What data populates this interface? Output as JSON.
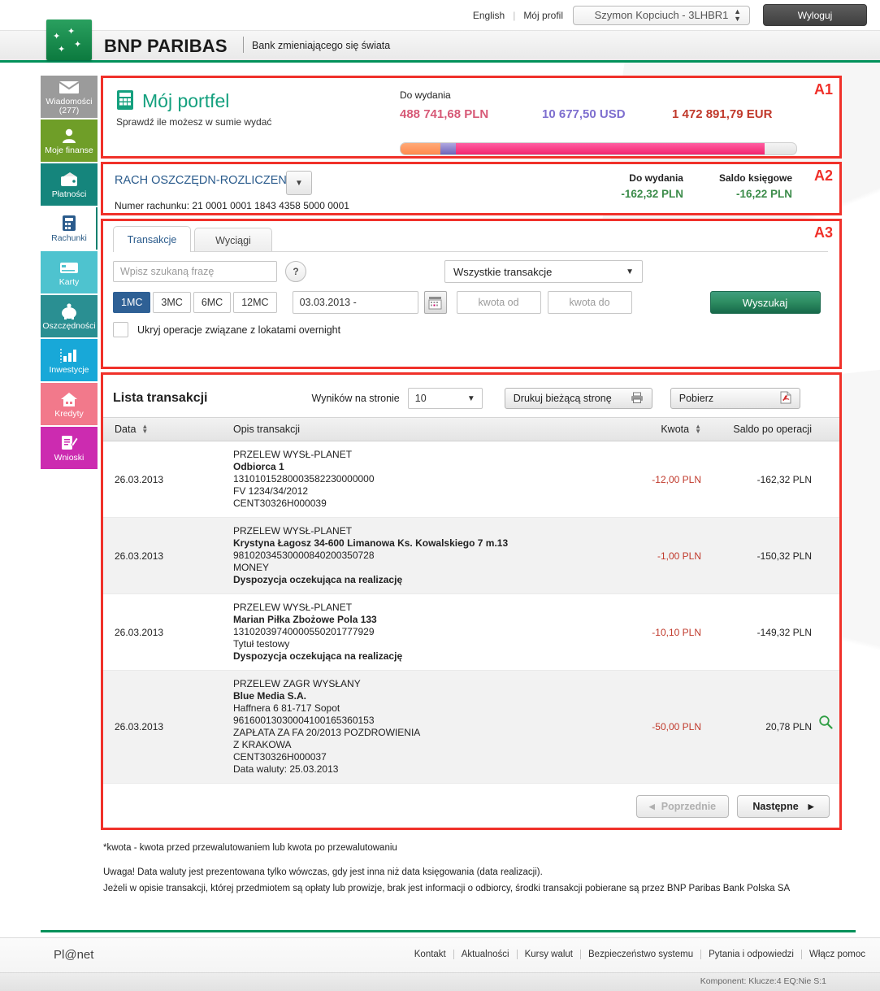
{
  "topbar": {
    "language": "English",
    "profile_link": "Mój profil",
    "user_select": "Szymon Kopciuch - 3LHBR1",
    "logout": "Wyloguj"
  },
  "brand": {
    "name": "BNP PARIBAS",
    "claim": "Bank zmieniającego się świata"
  },
  "sidebar": {
    "items": [
      {
        "label": "Wiadomości",
        "sub": "(277)",
        "icon": "envelope-icon",
        "color": "#9b9b9b"
      },
      {
        "label": "Moje finanse",
        "sub": "",
        "icon": "person-icon",
        "color": "#6f9e28"
      },
      {
        "label": "Płatności",
        "sub": "",
        "icon": "wallet-icon",
        "color": "#15857c"
      },
      {
        "label": "Rachunki",
        "sub": "",
        "icon": "account-book-icon",
        "color": "#ffffff",
        "active": true
      },
      {
        "label": "Karty",
        "sub": "",
        "icon": "credit-card-icon",
        "color": "#4ec3cf"
      },
      {
        "label": "Oszczędności",
        "sub": "",
        "icon": "piggy-bank-icon",
        "color": "#2a8f92"
      },
      {
        "label": "Inwestycje",
        "sub": "",
        "icon": "bar-chart-icon",
        "color": "#18a8d8"
      },
      {
        "label": "Kredyty",
        "sub": "",
        "icon": "house-icon",
        "color": "#f2798b"
      },
      {
        "label": "Wnioski",
        "sub": "",
        "icon": "form-pen-icon",
        "color": "#cc2bb0"
      }
    ]
  },
  "a1": {
    "badge": "A1",
    "title": "Mój portfel",
    "subtitle": "Sprawdź ile możesz w sumie wydać",
    "do_wydania_label": "Do wydania",
    "amounts": [
      {
        "value": "488 741,68 PLN",
        "color": "#d75a77"
      },
      {
        "value": "10 677,50 USD",
        "color": "#7e6fcf"
      },
      {
        "value": "1 472 891,79 EUR",
        "color": "#c0392b"
      }
    ],
    "progress": [
      {
        "name": "pln-segment",
        "pct": 10,
        "color": "#ff8a4d"
      },
      {
        "name": "usd-segment",
        "pct": 4,
        "color": "#6d63b8"
      },
      {
        "name": "eur-segment",
        "pct": 78,
        "color": "#f2246f"
      }
    ]
  },
  "a2": {
    "badge": "A2",
    "account_name": "RACH OSZCZĘDN-ROZLICZEN",
    "account_number_label": "Numer rachunku:",
    "account_number": "21  0001 0001 1843 4358 5000 0001",
    "balances": [
      {
        "title": "Do wydania",
        "value": "-162,32  PLN"
      },
      {
        "title": "Saldo księgowe",
        "value": "-16,22  PLN"
      }
    ]
  },
  "a3": {
    "badge": "A3",
    "tabs": [
      {
        "label": "Transakcje",
        "active": true
      },
      {
        "label": "Wyciągi",
        "active": false
      }
    ],
    "search_placeholder": "Wpisz szukaną frazę",
    "search_value": "",
    "help_glyph": "?",
    "transaction_type": "Wszystkie transakcje",
    "period_buttons": [
      {
        "label": "1MC",
        "selected": true
      },
      {
        "label": "3MC",
        "selected": false
      },
      {
        "label": "6MC",
        "selected": false
      },
      {
        "label": "12MC",
        "selected": false
      }
    ],
    "date_value": "03.03.2013 -",
    "amount_from_placeholder": "kwota od",
    "amount_from_value": "",
    "amount_to_placeholder": "kwota do",
    "amount_to_value": "",
    "search_button": "Wyszukaj",
    "hide_overnight_label": "Ukryj operacje związane z lokatami overnight",
    "hide_overnight_checked": false
  },
  "list": {
    "title": "Lista transakcji",
    "results_label": "Wyników na stronie",
    "results_value": "10",
    "print_button": "Drukuj bieżącą stronę",
    "download_button": "Pobierz",
    "columns": [
      "Data",
      "Opis transakcji",
      "Kwota",
      "Saldo po operacji"
    ],
    "rows": [
      {
        "date": "26.03.2013",
        "lines": [
          {
            "text": "PRZELEW WYSŁ-PLANET",
            "bold": false
          },
          {
            "text": "Odbiorca 1",
            "bold": true
          },
          {
            "text": "13101015280003582230000000",
            "bold": false
          },
          {
            "text": "FV 1234/34/2012",
            "bold": false
          },
          {
            "text": "CENT30326H000039",
            "bold": false
          }
        ],
        "amount": "-12,00 PLN",
        "balance": "-162,32 PLN",
        "has_magnifier": false
      },
      {
        "date": "26.03.2013",
        "lines": [
          {
            "text": "PRZELEW WYSŁ-PLANET",
            "bold": false
          },
          {
            "text": "Krystyna Łagosz 34-600 Limanowa Ks. Kowalskiego 7 m.13",
            "bold": true
          },
          {
            "text": "98102034530000840200350728",
            "bold": false
          },
          {
            "text": "MONEY",
            "bold": false
          },
          {
            "text": "Dyspozycja oczekująca na realizację",
            "bold": true
          }
        ],
        "amount": "-1,00 PLN",
        "balance": "-150,32 PLN",
        "has_magnifier": false
      },
      {
        "date": "26.03.2013",
        "lines": [
          {
            "text": "PRZELEW WYSŁ-PLANET",
            "bold": false
          },
          {
            "text": "Marian Piłka Zbożowe Pola 133",
            "bold": true
          },
          {
            "text": "13102039740000550201777929",
            "bold": false
          },
          {
            "text": "Tytuł testowy",
            "bold": false
          },
          {
            "text": "Dyspozycja oczekująca na realizację",
            "bold": true
          }
        ],
        "amount": "-10,10 PLN",
        "balance": "-149,32 PLN",
        "has_magnifier": false
      },
      {
        "date": "26.03.2013",
        "lines": [
          {
            "text": "PRZELEW ZAGR WYSŁANY",
            "bold": false
          },
          {
            "text": "Blue Media S.A.",
            "bold": true
          },
          {
            "text": "Haffnera 6 81-717 Sopot",
            "bold": false
          },
          {
            "text": "96160013030004100165360153",
            "bold": false
          },
          {
            "text": "ZAPŁATA ZA FA 20/2013 POZDROWIENIA",
            "bold": false
          },
          {
            "text": "Z KRAKOWA",
            "bold": false
          },
          {
            "text": "CENT30326H000037",
            "bold": false
          },
          {
            "text": "Data waluty: 25.03.2013",
            "bold": false
          }
        ],
        "amount": "-50,00 PLN",
        "balance": "20,78 PLN",
        "has_magnifier": true
      }
    ],
    "prev_button": "Poprzednie",
    "next_button": "Następne"
  },
  "notes": {
    "line1": "*kwota - kwota przed przewalutowaniem lub kwota po przewalutowaniu",
    "line2": "Uwaga! Data waluty jest prezentowana tylko wówczas, gdy jest inna niż data księgowania (data realizacji).",
    "line3": "Jeżeli w opisie transakcji, której przedmiotem są opłaty lub prowizje, brak jest informacji o odbiorcy, środki transakcji pobierane są przez BNP Paribas Bank Polska SA"
  },
  "footer": {
    "brand": "Pl@net",
    "links": [
      "Kontakt",
      "Aktualności",
      "Kursy walut",
      "Bezpieczeństwo systemu",
      "Pytania i odpowiedzi",
      "Włącz pomoc"
    ],
    "status": "Komponent: Klucze:4 EQ:Nie S:1"
  }
}
